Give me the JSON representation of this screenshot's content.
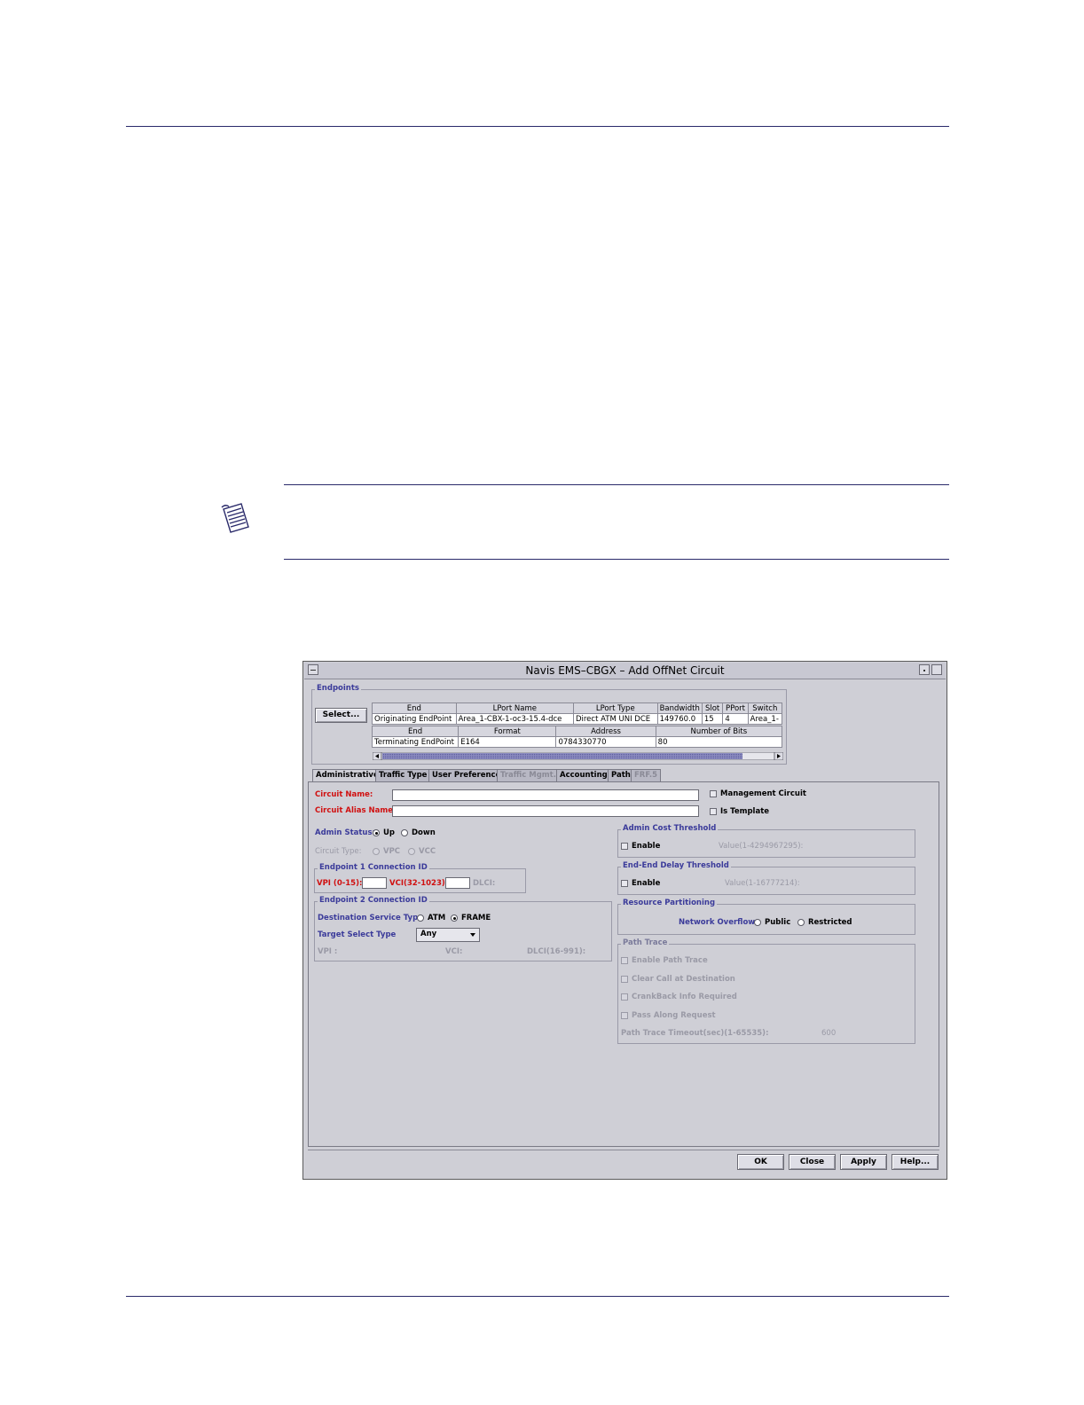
{
  "dialog": {
    "title": "Navis EMS–CBGX – Add OffNet Circuit",
    "endpoints": {
      "group_label": "Endpoints",
      "select_button": "Select...",
      "originating_headers": [
        "End",
        "LPort Name",
        "LPort Type",
        "Bandwidth",
        "Slot",
        "PPort",
        "Switch"
      ],
      "originating_row": [
        "Originating EndPoint",
        "Area_1-CBX-1-oc3-15.4-dce",
        "Direct ATM UNI DCE",
        "149760.0",
        "15",
        "4",
        "Area_1-"
      ],
      "terminating_headers": [
        "End",
        "Format",
        "Address",
        "Number of Bits"
      ],
      "terminating_row": [
        "Terminating EndPoint",
        "E164",
        "0784330770",
        "80"
      ]
    },
    "tabs": [
      "Administrative",
      "Traffic Type",
      "User Preference",
      "Traffic Mgmt.",
      "Accounting",
      "Path",
      "FRF.5"
    ],
    "admin": {
      "circuit_name_label": "Circuit Name:",
      "circuit_name_value": "",
      "circuit_alias_label": "Circuit Alias Name:",
      "circuit_alias_value": "",
      "management_circuit_label": "Management Circuit",
      "is_template_label": "Is Template",
      "admin_status_label": "Admin Status:",
      "admin_status_up": "Up",
      "admin_status_down": "Down",
      "circuit_type_label": "Circuit Type:",
      "circuit_type_vpc": "VPC",
      "circuit_type_vcc": "VCC",
      "ep1_group": "Endpoint 1 Connection ID",
      "vpi_label": "VPI (0-15):",
      "vci_label": "VCI(32-1023):",
      "dlci_label": "DLCI:",
      "ep2_group": "Endpoint 2 Connection ID",
      "dest_service_label": "Destination Service Type",
      "dest_atm": "ATM",
      "dest_frame": "FRAME",
      "target_select_label": "Target Select Type",
      "target_select_value": "Any",
      "ep2_vpi": "VPI :",
      "ep2_vci": "VCI:",
      "ep2_dlci": "DLCI(16-991):",
      "admin_cost_group": "Admin Cost Threshold",
      "admin_cost_enable": "Enable",
      "admin_cost_value": "Value(1-4294967295):",
      "delay_group": "End-End Delay Threshold",
      "delay_enable": "Enable",
      "delay_value": "Value(1-16777214):",
      "resource_group": "Resource Partitioning",
      "network_overflow_label": "Network Overflow:",
      "overflow_public": "Public",
      "overflow_restricted": "Restricted",
      "path_trace_group": "Path Trace",
      "enable_path_trace": "Enable Path Trace",
      "clear_call": "Clear Call at Destination",
      "crankback": "CrankBack Info Required",
      "pass_along": "Pass Along Request",
      "path_trace_timeout_label": "Path Trace Timeout(sec)(1-65535):",
      "path_trace_timeout_value": "600"
    },
    "buttons": {
      "ok": "OK",
      "close": "Close",
      "apply": "Apply",
      "help": "Help..."
    }
  }
}
